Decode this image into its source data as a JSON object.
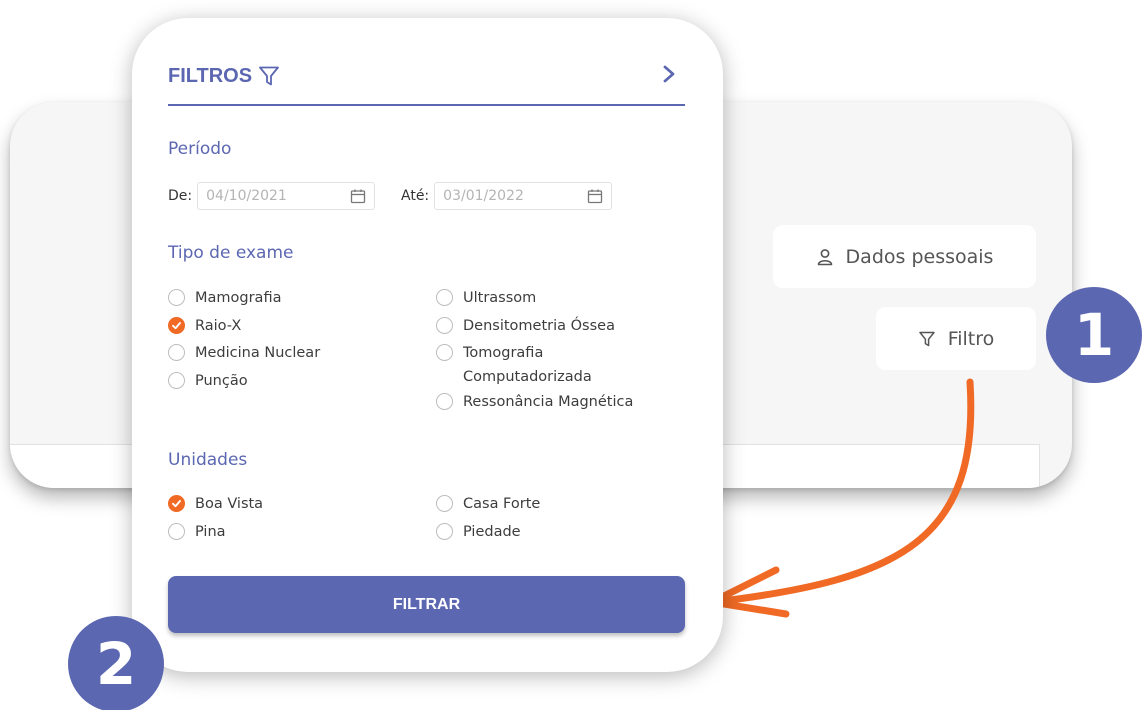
{
  "background": {
    "dados_button_label": "Dados pessoais",
    "dados_icon": "user-icon",
    "filtro_button_label": "Filtro",
    "filtro_icon": "funnel-icon"
  },
  "badges": {
    "step1": "1",
    "step2": "2"
  },
  "panel": {
    "title": "FILTROS",
    "title_icon": "funnel-icon",
    "close_icon": "chevron-right-icon",
    "periodo": {
      "title": "Período",
      "from_label": "De:",
      "from_value": "04/10/2021",
      "to_label": "Até:",
      "to_value": "03/01/2022"
    },
    "tipo_exame": {
      "title": "Tipo de exame",
      "options": [
        {
          "label": "Mamografia",
          "checked": false
        },
        {
          "label": "Raio-X",
          "checked": true
        },
        {
          "label": "Medicina Nuclear",
          "checked": false
        },
        {
          "label": "Punção",
          "checked": false
        },
        {
          "label": "Ultrassom",
          "checked": false
        },
        {
          "label": "Densitometria Óssea",
          "checked": false
        },
        {
          "label": "Tomografia Computadorizada",
          "checked": false
        },
        {
          "label": "Ressonância Magnética",
          "checked": false
        }
      ]
    },
    "unidades": {
      "title": "Unidades",
      "options": [
        {
          "label": "Boa Vista",
          "checked": true
        },
        {
          "label": "Pina",
          "checked": false
        },
        {
          "label": "Casa Forte",
          "checked": false
        },
        {
          "label": "Piedade",
          "checked": false
        }
      ]
    },
    "submit_label": "FILTRAR"
  },
  "colors": {
    "accent": "#5b67b1",
    "selected": "#f06a25",
    "arrow": "#f06a25"
  }
}
